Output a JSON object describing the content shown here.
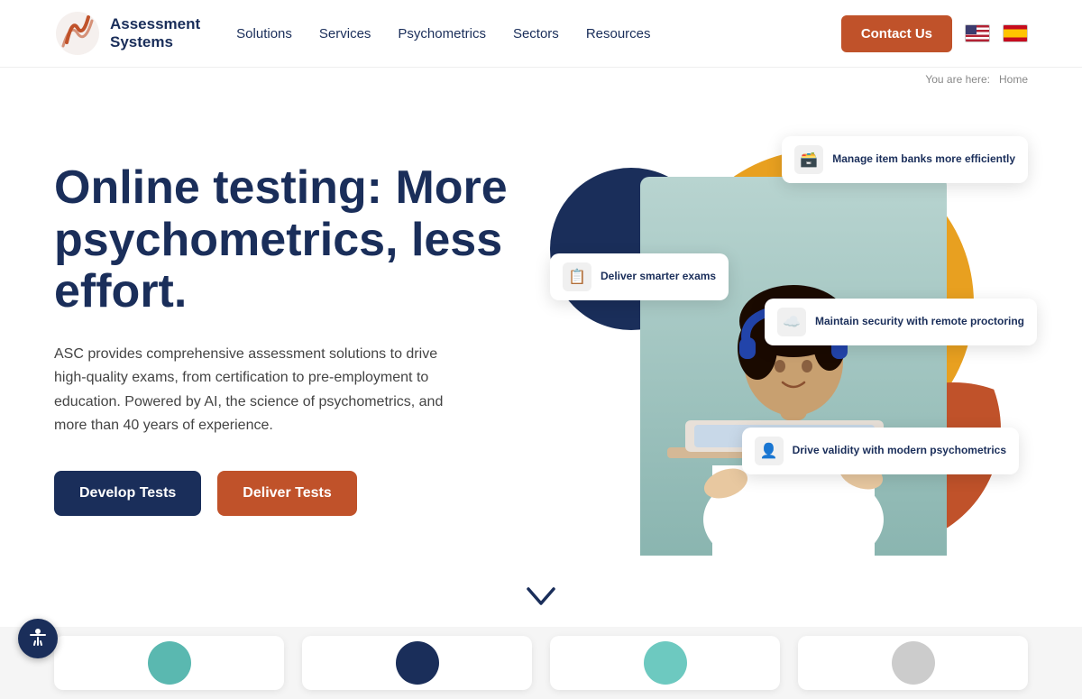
{
  "header": {
    "logo_name": "Assessment\nSystems",
    "nav_items": [
      {
        "label": "Solutions",
        "id": "solutions"
      },
      {
        "label": "Services",
        "id": "services"
      },
      {
        "label": "Psychometrics",
        "id": "psychometrics"
      },
      {
        "label": "Sectors",
        "id": "sectors"
      },
      {
        "label": "Resources",
        "id": "resources"
      }
    ],
    "contact_button": "Contact Us",
    "lang_en": "EN",
    "lang_es": "ES"
  },
  "breadcrumb": {
    "prefix": "You are here:",
    "home": "Home"
  },
  "hero": {
    "title": "Online testing: More psychometrics, less effort.",
    "description": "ASC provides comprehensive assessment solutions to drive high-quality exams, from certification to pre-employment to education. Powered by AI, the science of psychometrics, and more than 40 years of experience.",
    "btn_develop": "Develop Tests",
    "btn_deliver": "Deliver Tests"
  },
  "feature_cards": [
    {
      "id": "manage",
      "text": "Manage item banks more efficiently",
      "icon": "🗃️"
    },
    {
      "id": "deliver",
      "text": "Deliver smarter exams",
      "icon": "📋"
    },
    {
      "id": "maintain",
      "text": "Maintain security with remote proctoring",
      "icon": "☁️"
    },
    {
      "id": "drive",
      "text": "Drive validity with modern psychometrics",
      "icon": "👤"
    }
  ],
  "scroll_arrow": "∨",
  "bottom_cards": [
    {
      "id": "card1",
      "circle_class": "circle-teal"
    },
    {
      "id": "card2",
      "circle_class": "circle-navy"
    },
    {
      "id": "card3",
      "circle_class": "circle-teal2"
    },
    {
      "id": "card4",
      "circle_class": "circle-gray"
    }
  ],
  "colors": {
    "navy": "#1a2e5a",
    "orange": "#c0522a",
    "gold": "#e8a020",
    "teal": "#5ab8b0"
  }
}
